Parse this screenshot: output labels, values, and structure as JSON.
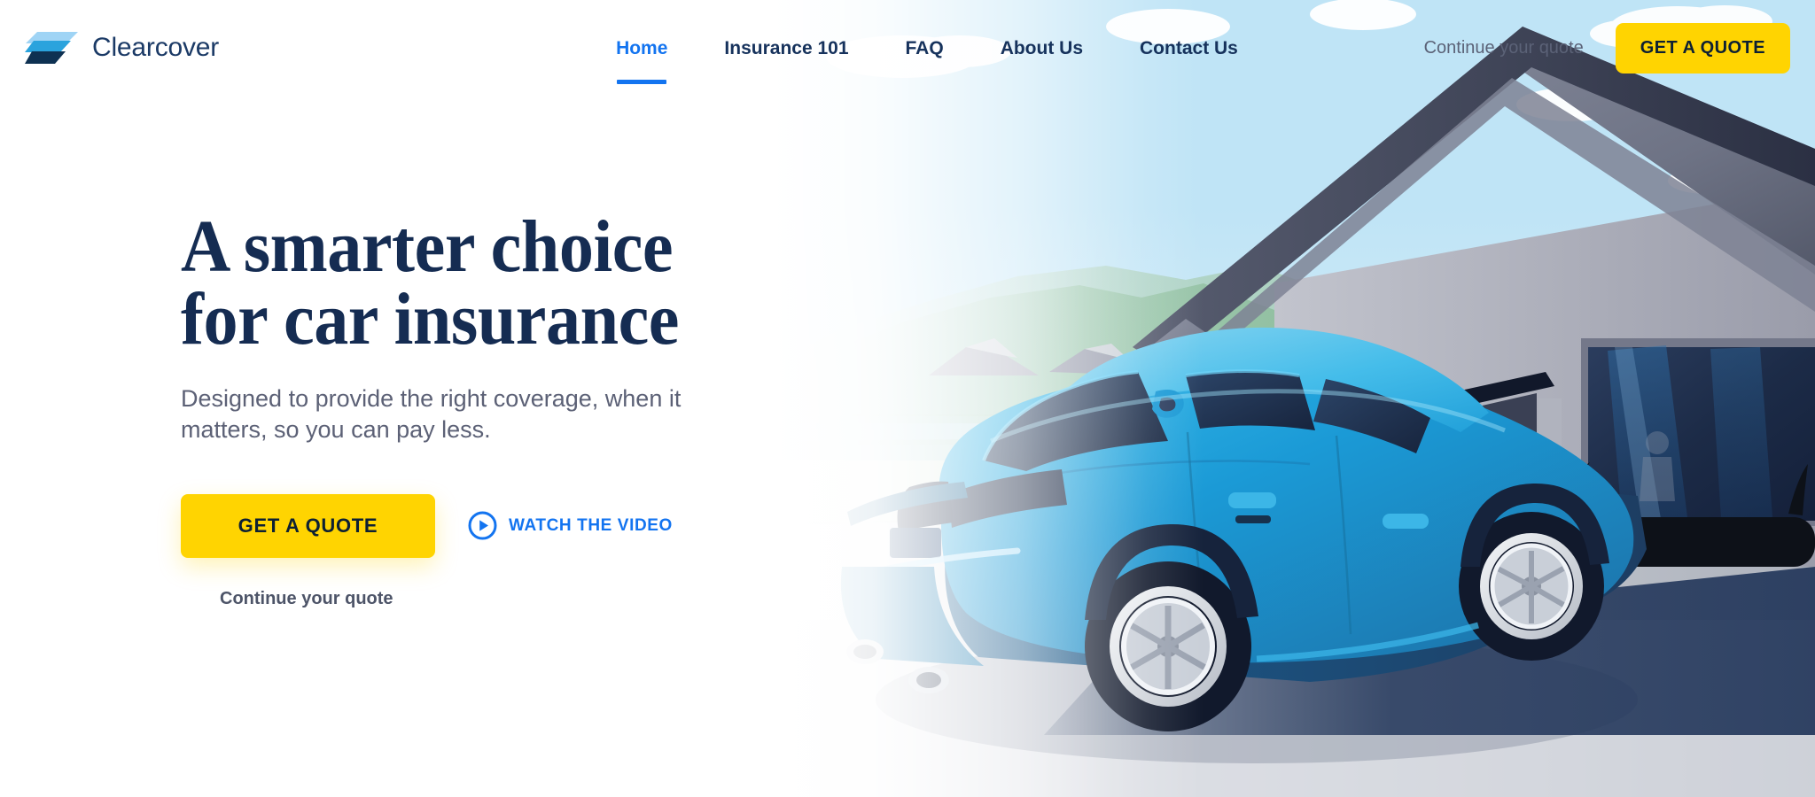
{
  "brand": {
    "name": "Clearcover",
    "logo_icon": "clearcover-stacked-parallelogram-logo",
    "colors": {
      "light": "#9fd4f5",
      "mid": "#2aa3dd",
      "dark": "#0e3152",
      "wordmark": "#1b3a66"
    }
  },
  "nav": {
    "items": [
      {
        "label": "Home",
        "active": true
      },
      {
        "label": "Insurance 101",
        "active": false
      },
      {
        "label": "FAQ",
        "active": false
      },
      {
        "label": "About Us",
        "active": false
      },
      {
        "label": "Contact Us",
        "active": false
      }
    ],
    "active_color": "#1374f0",
    "inactive_color": "#16325c"
  },
  "header": {
    "continue_quote_label": "Continue your quote",
    "get_quote_label": "GET A QUOTE",
    "button_color": "#ffd401",
    "button_text_color": "#0d2033"
  },
  "hero": {
    "headline_line1": "A smarter choice",
    "headline_line2": "for car insurance",
    "headline_color": "#152c52",
    "subheadline": "Designed to provide the right coverage, when it matters, so you can pay less.",
    "subheadline_color": "#5c6176",
    "cta_label": "GET A QUOTE",
    "watch_video_label": "WATCH THE VIDEO",
    "watch_video_icon": "play-circle-icon",
    "watch_video_color": "#1374f0",
    "continue_quote_label": "Continue your quote"
  },
  "illustration": {
    "name": "blue-sedan-parked-in-front-of-modern-house",
    "sky_color": "#bfe4f6",
    "cloud_color": "#ffffff",
    "house_wall_color": "#a8a9b6",
    "roof_color": "#5d6070",
    "window_color": "#1d2b47",
    "car_color": "#1a9ad6",
    "car_dark_color": "#1d4468",
    "wheel_color": "#d9dde4",
    "hill_color": "#7bab86",
    "driveway_color": "#c9ccd4",
    "shadow_color": "#22365a"
  }
}
